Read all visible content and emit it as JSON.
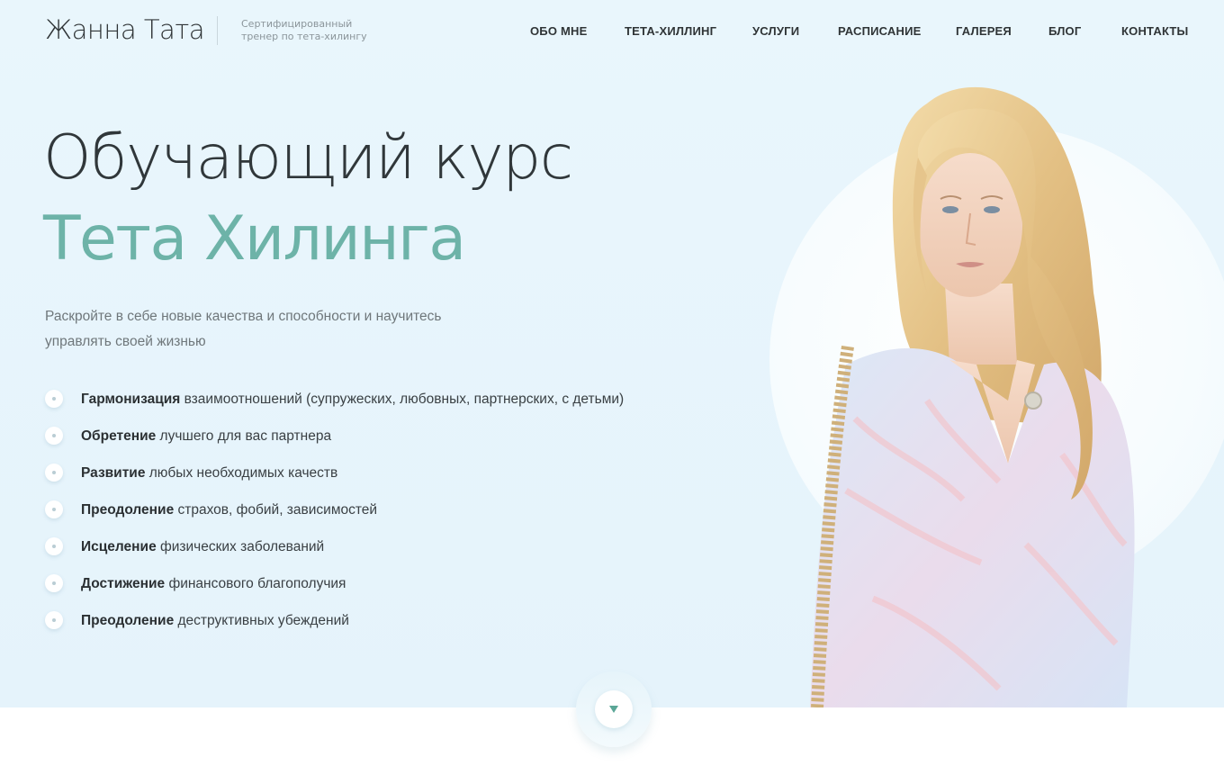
{
  "header": {
    "logo": "Жанна Тата",
    "tagline": "Сертифицированный тренер по тета-хилингу"
  },
  "nav": {
    "items": [
      {
        "label": "ОБО МНЕ"
      },
      {
        "label": "ТЕТА-ХИЛЛИНГ"
      },
      {
        "label": "УСЛУГИ"
      },
      {
        "label": "РАСПИСАНИЕ"
      },
      {
        "label": "ГАЛЕРЕЯ"
      },
      {
        "label": "БЛОГ"
      },
      {
        "label": "КОНТАКТЫ"
      }
    ]
  },
  "hero": {
    "title_line1": "Обучающий курс",
    "title_line2": "Тета Хилинга",
    "lead": "Раскройте в себе новые качества и способности и научитесь управлять своей жизнью",
    "benefits": [
      {
        "bold": "Гармонизация",
        "text": " взаимоотношений (супружеских, любовных, партнерских, с детьми)"
      },
      {
        "bold": "Обретение",
        "text": " лучшего для вас партнера"
      },
      {
        "bold": "Развитие",
        "text": " любых необходимых качеств"
      },
      {
        "bold": "Преодоление",
        "text": " страхов, фобий, зависимостей"
      },
      {
        "bold": "Исцеление",
        "text": " физических заболеваний"
      },
      {
        "bold": "Достижение",
        "text": " финансового благополучия"
      },
      {
        "bold": "Преодоление",
        "text": " деструктивных убеждений"
      }
    ]
  },
  "icons": {
    "scroll": "chevron-down-icon",
    "bullet": "bullet-dot-icon"
  },
  "colors": {
    "accent": "#6db3a8",
    "hero_background": "#e9f6fc",
    "text_dark": "#2f3436",
    "scroll_arrow": "#5aa696"
  }
}
